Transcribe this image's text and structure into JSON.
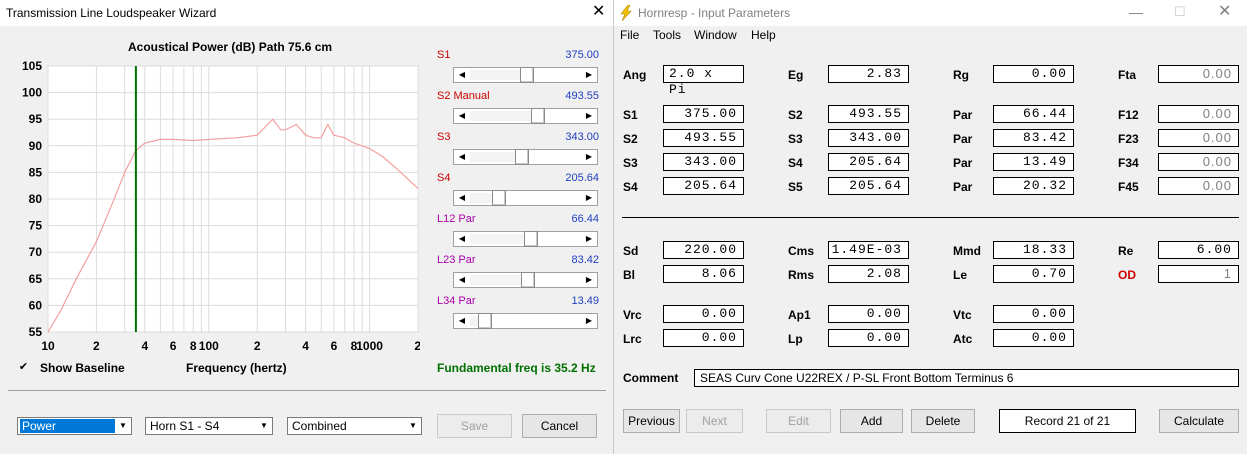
{
  "wizard": {
    "title": "Transmission Line Loudspeaker Wizard",
    "chart_title": "Acoustical Power (dB)   Path 75.6 cm",
    "x_label": "Frequency (hertz)",
    "fund_freq": "Fundamental freq is 35.2 Hz",
    "show_baseline": "Show Baseline",
    "show_baseline_checked": true,
    "sliders": [
      {
        "label": "S1",
        "value": "375.00",
        "color": "#cc0000",
        "pos": 0.5
      },
      {
        "label": "S2  Manual",
        "value": "493.55",
        "color": "#cc0000",
        "pos": 0.62
      },
      {
        "label": "S3",
        "value": "343.00",
        "color": "#cc0000",
        "pos": 0.45
      },
      {
        "label": "S4",
        "value": "205.64",
        "color": "#cc0000",
        "pos": 0.22
      },
      {
        "label": "L12  Par",
        "value": "66.44",
        "color": "#aa00aa",
        "pos": 0.55
      },
      {
        "label": "L23  Par",
        "value": "83.42",
        "color": "#aa00aa",
        "pos": 0.52
      },
      {
        "label": "L34  Par",
        "value": "13.49",
        "color": "#aa00aa",
        "pos": 0.08
      }
    ],
    "dropdowns": {
      "mode": "Power",
      "horn": "Horn S1 - S4",
      "combine": "Combined"
    },
    "save_label": "Save",
    "cancel_label": "Cancel",
    "y_ticks": [
      "105",
      "100",
      "95",
      "90",
      "85",
      "80",
      "75",
      "70",
      "65",
      "60",
      "55"
    ],
    "x_ticks": [
      "10",
      "2",
      "4",
      "6",
      "8",
      "100",
      "2",
      "4",
      "6",
      "8",
      "1000",
      "2"
    ]
  },
  "chart_data": {
    "type": "line",
    "title": "Acoustical Power (dB)   Path 75.6 cm",
    "xlabel": "Frequency (hertz)",
    "ylabel": "",
    "xscale": "log",
    "xlim": [
      10,
      2000
    ],
    "ylim": [
      55,
      105
    ],
    "x_tick_labels": [
      "10",
      "2",
      "4",
      "6",
      "8",
      "100",
      "2",
      "4",
      "6",
      "8",
      "1000",
      "2"
    ],
    "y_tick_labels": [
      "105",
      "100",
      "95",
      "90",
      "85",
      "80",
      "75",
      "70",
      "65",
      "60",
      "55"
    ],
    "grid": true,
    "marker_line_x": 35.2,
    "series": [
      {
        "color": "#f4a0a0",
        "x": [
          10,
          12,
          15,
          20,
          25,
          30,
          35,
          40,
          50,
          60,
          80,
          100,
          150,
          200,
          250,
          280,
          300,
          350,
          400,
          450,
          500,
          550,
          600,
          700,
          800,
          1000,
          1200,
          1500,
          2000
        ],
        "y": [
          55,
          59,
          65,
          72,
          79,
          85,
          89,
          90.5,
          91.2,
          91.2,
          91,
          91.2,
          91.5,
          92,
          95,
          93,
          93,
          94,
          92,
          91.5,
          91.5,
          94,
          92,
          91.5,
          90.5,
          89.5,
          88,
          85.5,
          82
        ]
      }
    ]
  },
  "hornresp": {
    "title": "Hornresp - Input Parameters",
    "menu": [
      "File",
      "Tools",
      "Window",
      "Help"
    ],
    "rows": [
      [
        {
          "l": "Ang",
          "v": "2.0 x Pi",
          "left": true
        },
        {
          "l": "Eg",
          "v": "2.83"
        },
        {
          "l": "Rg",
          "v": "0.00"
        },
        {
          "l": "Fta",
          "v": "0.00",
          "gray": true
        }
      ],
      [
        {
          "l": "S1",
          "v": "375.00"
        },
        {
          "l": "S2",
          "v": "493.55"
        },
        {
          "l": "Par",
          "v": "66.44"
        },
        {
          "l": "F12",
          "v": "0.00",
          "gray": true
        }
      ],
      [
        {
          "l": "S2",
          "v": "493.55"
        },
        {
          "l": "S3",
          "v": "343.00"
        },
        {
          "l": "Par",
          "v": "83.42"
        },
        {
          "l": "F23",
          "v": "0.00",
          "gray": true
        }
      ],
      [
        {
          "l": "S3",
          "v": "343.00"
        },
        {
          "l": "S4",
          "v": "205.64"
        },
        {
          "l": "Par",
          "v": "13.49"
        },
        {
          "l": "F34",
          "v": "0.00",
          "gray": true
        }
      ],
      [
        {
          "l": "S4",
          "v": "205.64"
        },
        {
          "l": "S5",
          "v": "205.64"
        },
        {
          "l": "Par",
          "v": "20.32"
        },
        {
          "l": "F45",
          "v": "0.00",
          "gray": true
        }
      ],
      [
        {
          "l": "Sd",
          "v": "220.00"
        },
        {
          "l": "Cms",
          "v": "1.49E-03"
        },
        {
          "l": "Mmd",
          "v": "18.33"
        },
        {
          "l": "Re",
          "v": "6.00"
        }
      ],
      [
        {
          "l": "Bl",
          "v": "8.06"
        },
        {
          "l": "Rms",
          "v": "2.08"
        },
        {
          "l": "Le",
          "v": "0.70"
        },
        {
          "l": "OD",
          "v": "1",
          "red": true,
          "gray": true
        }
      ],
      [
        {
          "l": "Vrc",
          "v": "0.00"
        },
        {
          "l": "Ap1",
          "v": "0.00"
        },
        {
          "l": "Vtc",
          "v": "0.00"
        }
      ],
      [
        {
          "l": "Lrc",
          "v": "0.00"
        },
        {
          "l": "Lp",
          "v": "0.00"
        },
        {
          "l": "Atc",
          "v": "0.00"
        }
      ]
    ],
    "comment_label": "Comment",
    "comment": "SEAS Curv Cone U22REX / P-SL Front Bottom Terminus 6",
    "buttons": {
      "previous": "Previous",
      "next": "Next",
      "edit": "Edit",
      "add": "Add",
      "delete": "Delete",
      "record": "Record 21 of 21",
      "calculate": "Calculate"
    }
  }
}
